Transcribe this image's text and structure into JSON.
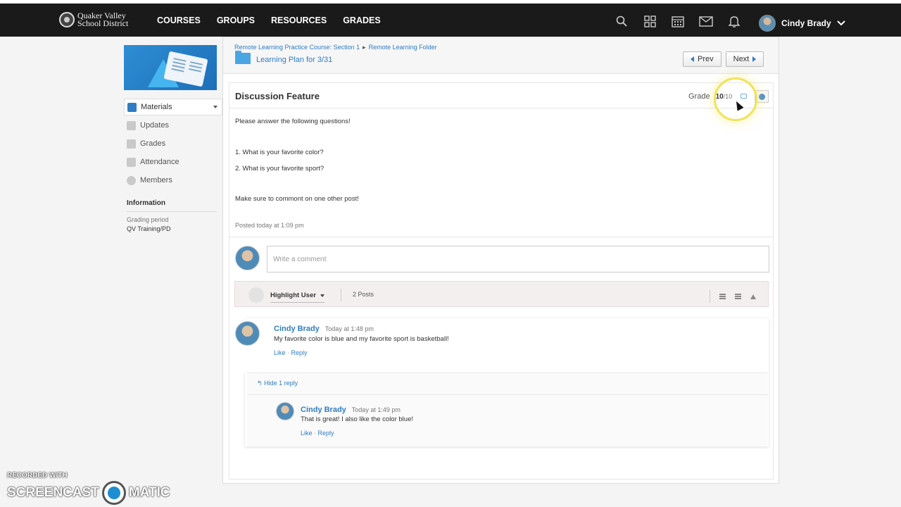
{
  "header": {
    "logo_line1": "Quaker Valley",
    "logo_line2": "School District",
    "nav": [
      "COURSES",
      "GROUPS",
      "RESOURCES",
      "GRADES"
    ],
    "user_name": "Cindy Brady"
  },
  "sidebar": {
    "items": [
      {
        "label": "Materials",
        "icon": "materials-icon"
      },
      {
        "label": "Updates",
        "icon": "updates-icon"
      },
      {
        "label": "Grades",
        "icon": "grades-icon"
      },
      {
        "label": "Attendance",
        "icon": "attendance-icon"
      },
      {
        "label": "Members",
        "icon": "members-icon"
      }
    ],
    "info_heading": "Information",
    "grading_period_label": "Grading period",
    "grading_period_value": "QV Training/PD"
  },
  "breadcrumb": {
    "course": "Remote Learning Practice Course: Section 1",
    "folder": "Remote Learning Folder",
    "title": "Learning Plan for 3/31"
  },
  "pager": {
    "prev": "Prev",
    "next": "Next"
  },
  "discussion": {
    "title": "Discussion Feature",
    "grade_label": "Grade",
    "grade_value": "10",
    "grade_max": "/10",
    "lines": [
      "Please answer the following questions!",
      "1. What is your favorite color?",
      "2. What is your favorite sport?",
      "Make sure to commont on one other post!"
    ],
    "posted": "Posted today at 1:09 pm"
  },
  "compose": {
    "placeholder": "Write a comment"
  },
  "filter": {
    "highlight_user": "Highlight User",
    "posts_count": "2 Posts"
  },
  "posts": [
    {
      "author": "Cindy Brady",
      "time": "Today at 1:48 pm",
      "message": "My favorite color is blue and my favorite sport is basketball!",
      "like": "Like",
      "reply": "Reply"
    }
  ],
  "replies": {
    "toggle": "Hide 1 reply",
    "items": [
      {
        "author": "Cindy Brady",
        "time": "Today at 1:49 pm",
        "message": "That is great! I also like the color blue!",
        "like": "Like",
        "reply": "Reply"
      }
    ]
  },
  "watermark": {
    "small": "RECORDED WITH",
    "big_left": "SCREENCAST",
    "big_right": "MATIC"
  }
}
